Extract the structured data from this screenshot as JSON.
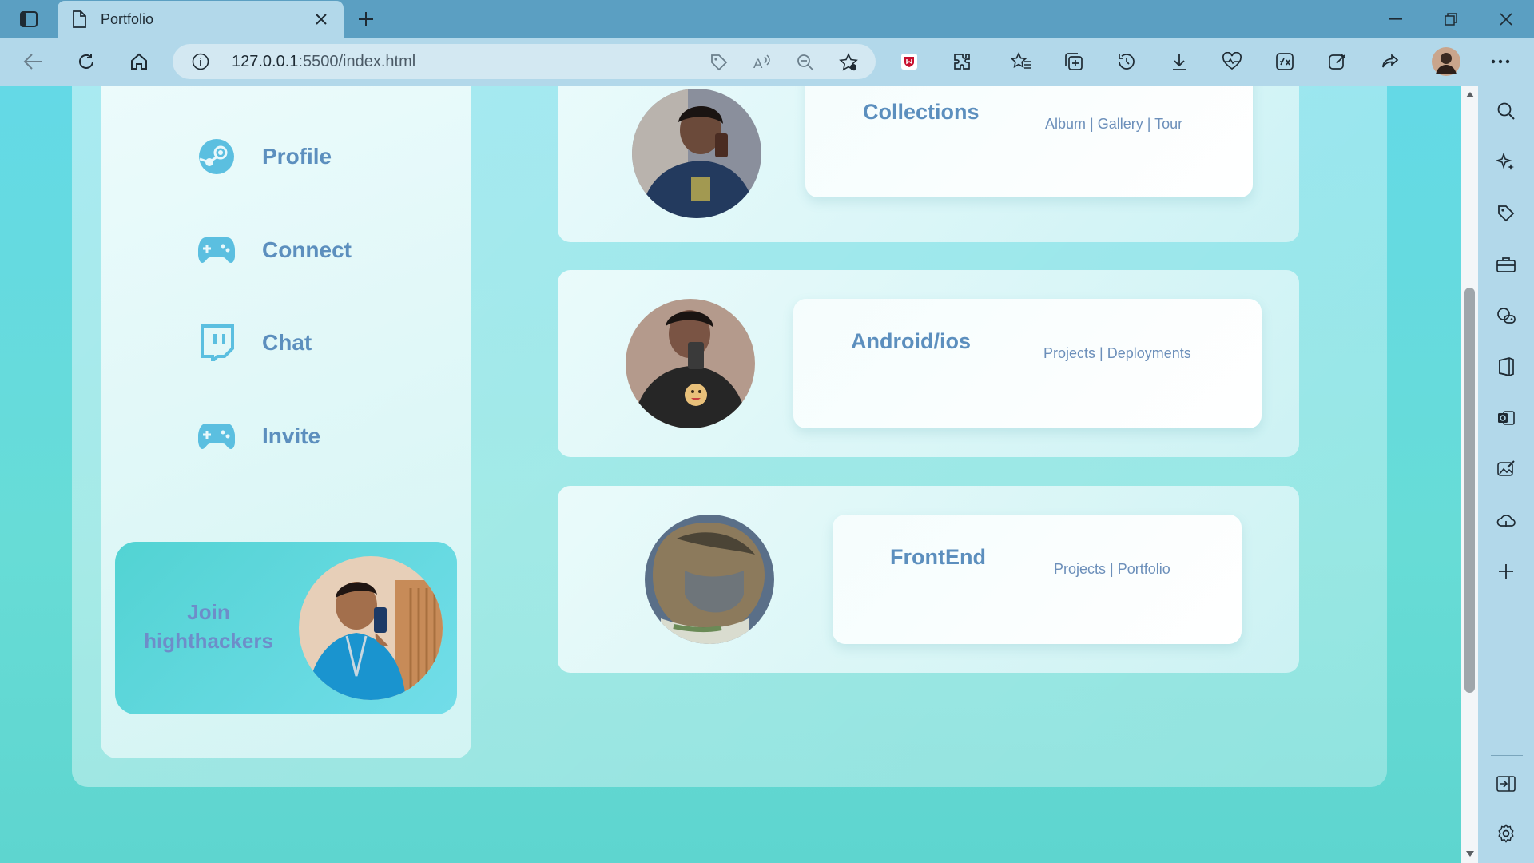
{
  "browser": {
    "tab_title": "Portfolio",
    "url_host": "127.0.0.1",
    "url_rest": ":5500/index.html"
  },
  "nav": {
    "items": [
      {
        "label": "Profile",
        "icon": "steam-icon"
      },
      {
        "label": "Connect",
        "icon": "gamepad-icon"
      },
      {
        "label": "Chat",
        "icon": "twitch-icon"
      },
      {
        "label": "Invite",
        "icon": "gamepad-icon"
      }
    ]
  },
  "join": {
    "line1": "Join",
    "line2": "highthackers"
  },
  "cards": [
    {
      "title": "Collections",
      "links": "Album | Gallery | Tour"
    },
    {
      "title": "Android/ios",
      "links": "Projects | Deployments"
    },
    {
      "title": "FrontEnd",
      "links": "Projects | Portfolio"
    }
  ],
  "colors": {
    "accent_text": "#5c8fbe",
    "icon_blue": "#5bbfe0",
    "chrome": "#b2d8ea",
    "titlebar": "#5b9fc2",
    "page_bg": "#64d9e6"
  }
}
